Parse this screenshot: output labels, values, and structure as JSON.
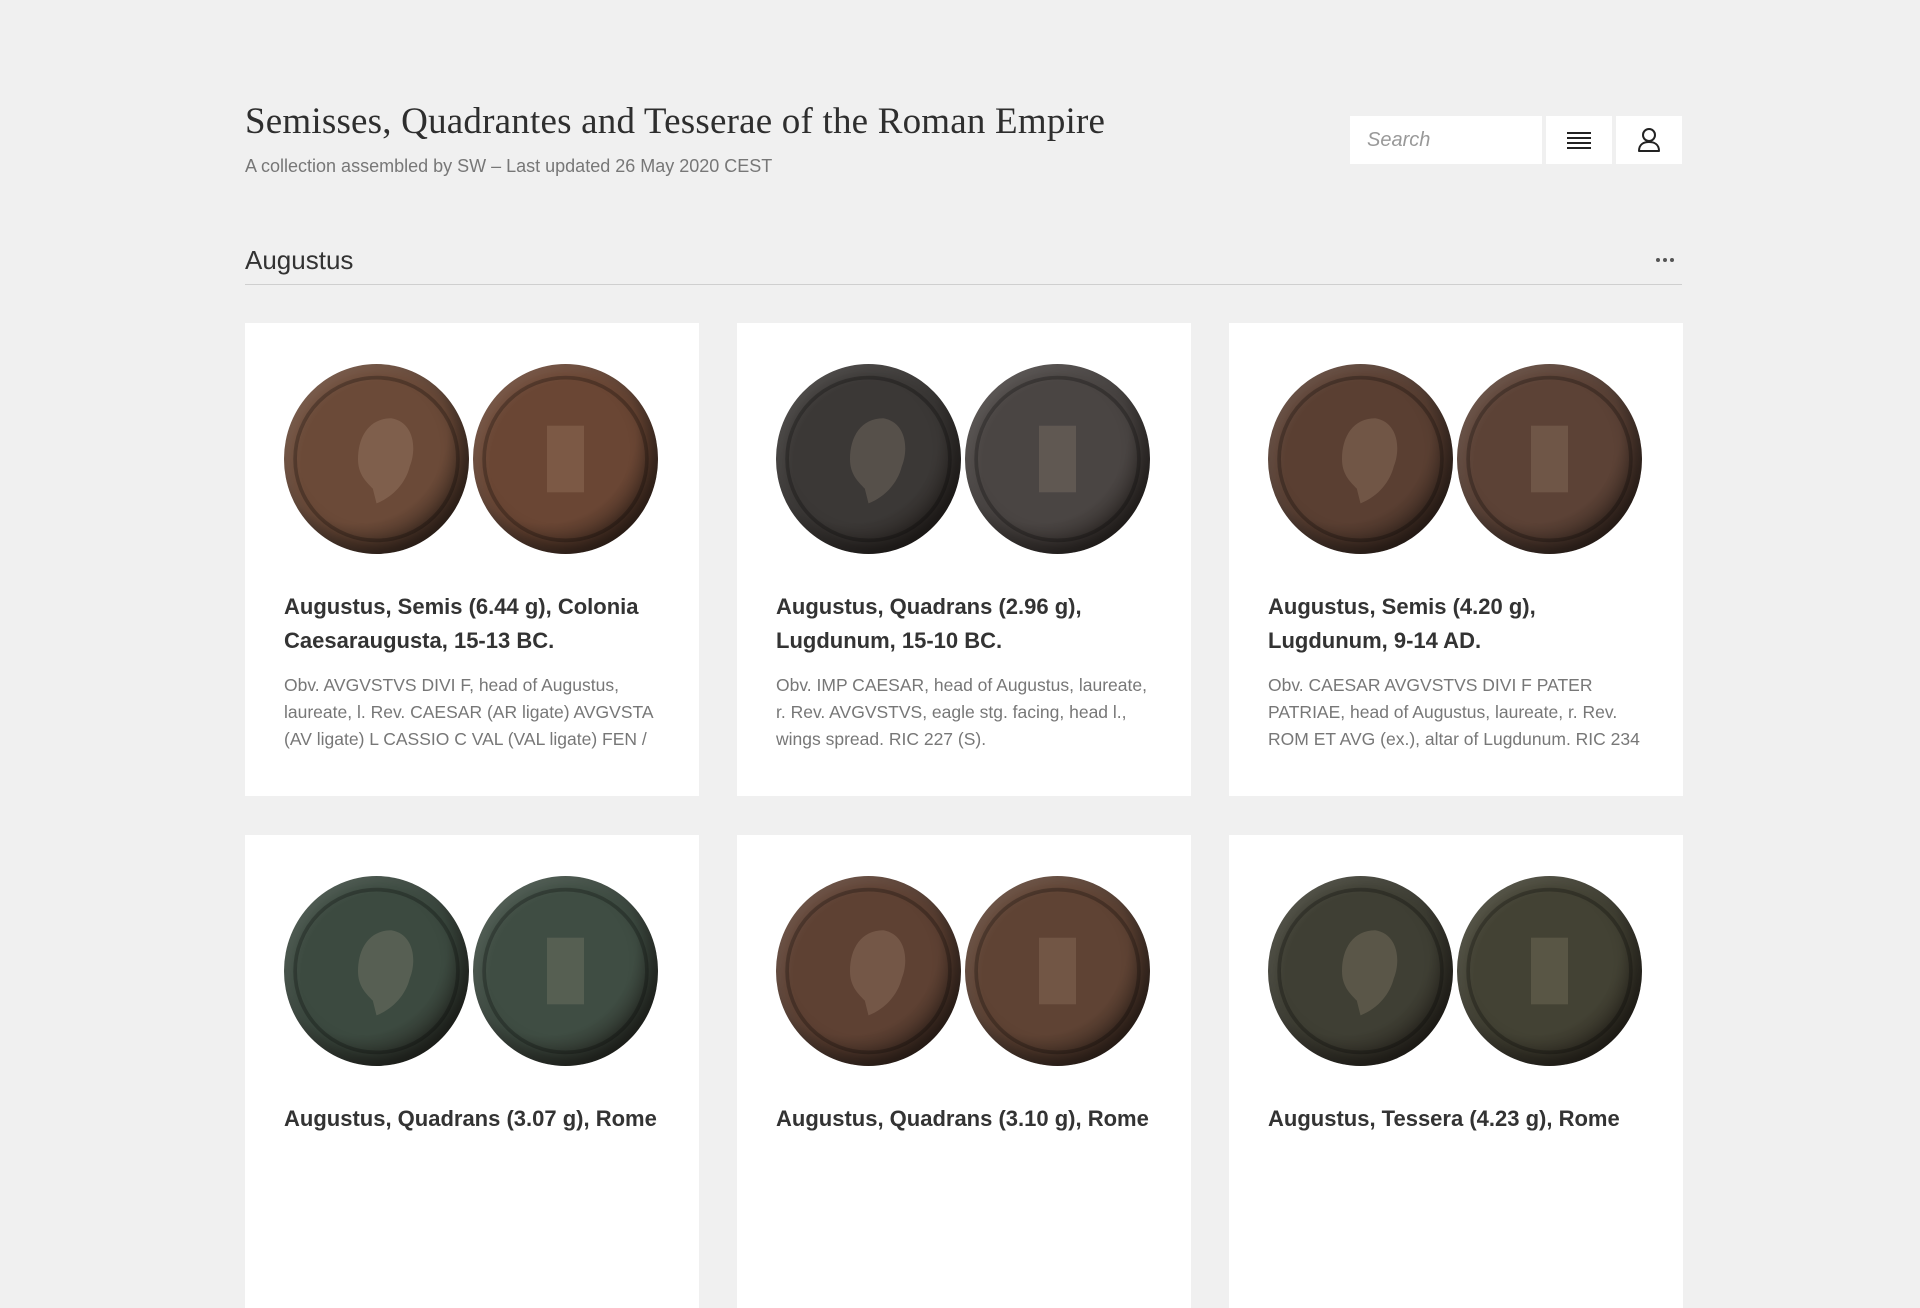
{
  "header": {
    "title": "Semisses, Quadrantes and Tesserae of the Roman Empire",
    "subtitle": "A collection assembled by SW – Last updated 26 May 2020 CEST"
  },
  "search": {
    "placeholder": "Search",
    "value": ""
  },
  "icons": {
    "menu": "menu-icon",
    "user": "user-icon",
    "more": "more-horizontal-icon"
  },
  "section": {
    "title": "Augustus"
  },
  "cards": [
    {
      "title": "Augustus, Semis (6.44 g), Colonia Caesaraugusta, 15-13 BC.",
      "description": "Obv. AVGVSTVS DIVI F, head of Augustus, laureate, l. Rev. CAESAR (AR ligate) AVGVSTA (AV ligate) L CASSIO C VAL (VAL ligate) FEN /",
      "coin_colors": [
        "#6b4a38",
        "#6a4634"
      ]
    },
    {
      "title": "Augustus, Quadrans (2.96 g), Lugdunum, 15-10 BC.",
      "description": "Obv. IMP CAESAR, head of Augustus, laureate, r. Rev. AVGVSTVS, eagle stg. facing, head l., wings spread. RIC 227 (S).",
      "coin_colors": [
        "#3b3836",
        "#4a4543"
      ]
    },
    {
      "title": "Augustus, Semis (4.20 g), Lugdunum, 9-14 AD.",
      "description": "Obv. CAESAR AVGVSTVS DIVI F PATER PATRIAE, head of Augustus, laureate, r. Rev. ROM ET AVG (ex.), altar of Lugdunum. RIC 234",
      "coin_colors": [
        "#5a3f32",
        "#5c4236"
      ]
    },
    {
      "title": "Augustus, Quadrans (3.07 g), Rome",
      "description": "",
      "coin_colors": [
        "#3c4a40",
        "#3f4d43"
      ]
    },
    {
      "title": "Augustus, Quadrans (3.10 g), Rome",
      "description": "",
      "coin_colors": [
        "#5e4133",
        "#5f4334"
      ]
    },
    {
      "title": "Augustus, Tessera (4.23 g), Rome",
      "description": "",
      "coin_colors": [
        "#3f3f34",
        "#434234"
      ]
    }
  ]
}
